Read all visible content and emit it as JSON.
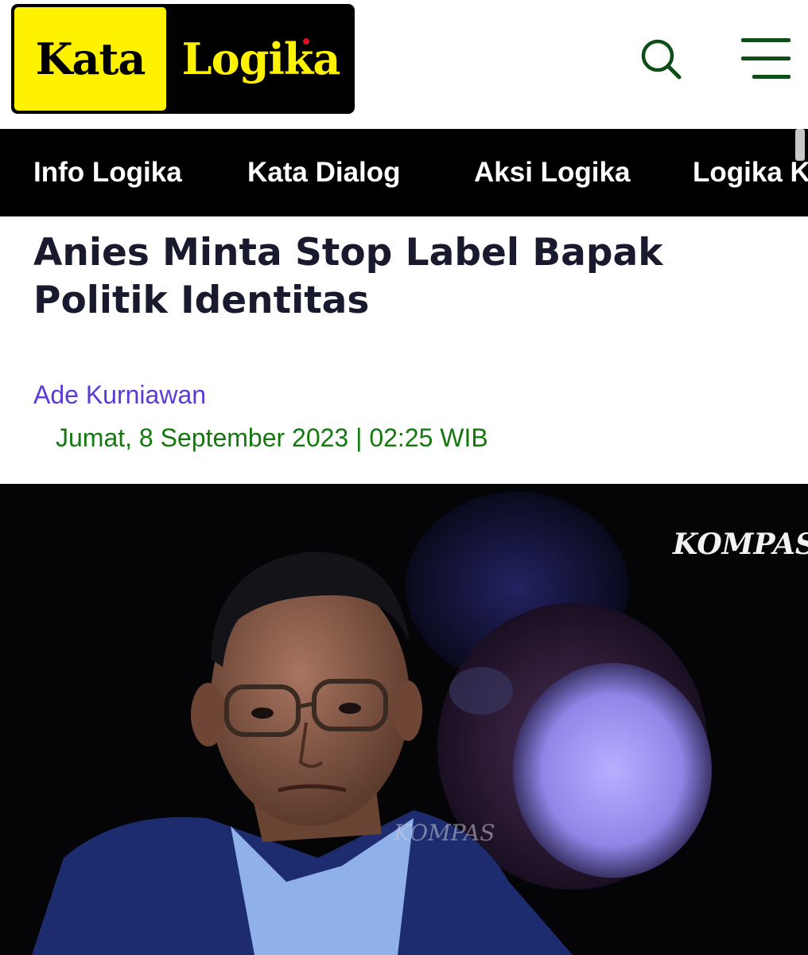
{
  "brand": {
    "word1": "Kata",
    "word2": "Logika",
    "colors": {
      "yellow": "#fff200",
      "black": "#000000",
      "dot": "#e0102a"
    }
  },
  "header": {
    "search_icon": "search-icon",
    "menu_icon": "hamburger-menu-icon",
    "icon_color": "#0e4d16"
  },
  "nav": {
    "items": [
      "Info Logika",
      "Kata Dialog",
      "Aksi Logika",
      "Logika K"
    ]
  },
  "article": {
    "title": "Anies Minta Stop Label Bapak Politik Identitas",
    "author": "Ade Kurniawan",
    "date": "Jumat, 8 September 2023 | 02:25 WIB",
    "colors": {
      "title": "#1a1a2e",
      "author": "#5b3bd6",
      "date": "#15780f"
    }
  },
  "photo": {
    "watermark_top": "KOMPAS",
    "watermark_center": "KOMPAS"
  }
}
